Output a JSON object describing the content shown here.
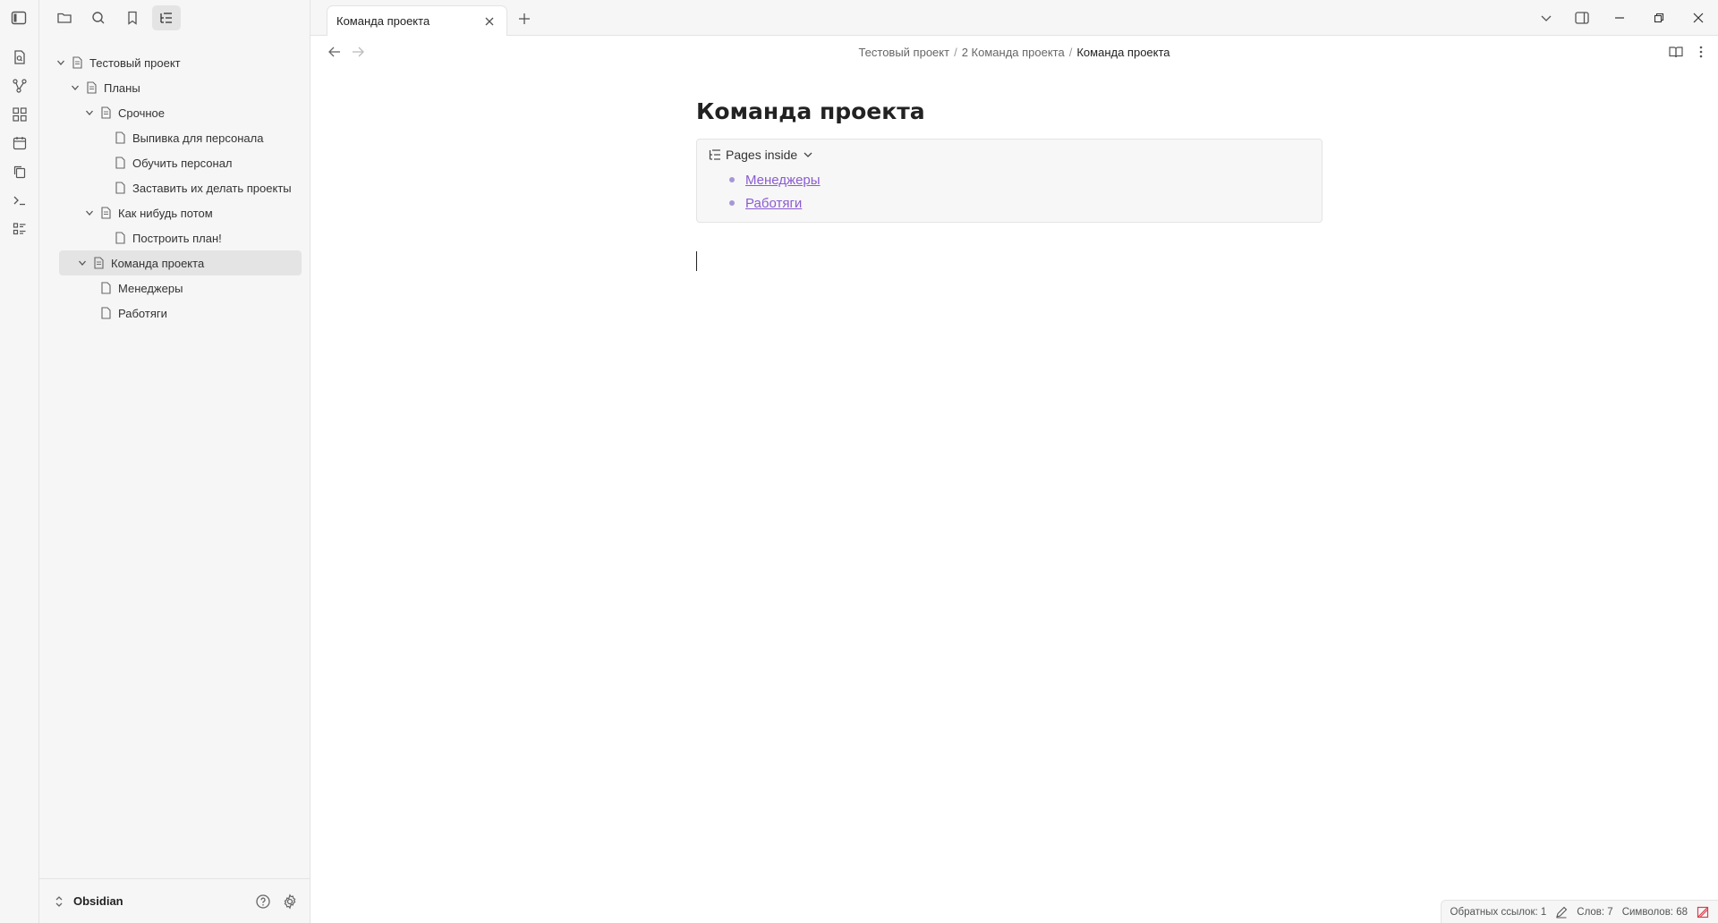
{
  "sidebar": {
    "tree": [
      {
        "label": "Тестовый проект"
      },
      {
        "label": "Планы"
      },
      {
        "label": "Срочное"
      },
      {
        "label": "Выпивка для персонала"
      },
      {
        "label": "Обучить персонал"
      },
      {
        "label": "Заставить их делать проекты"
      },
      {
        "label": "Как нибудь потом"
      },
      {
        "label": "Построить план!"
      },
      {
        "label": "Команда проекта"
      },
      {
        "label": "Менеджеры"
      },
      {
        "label": "Работяги"
      }
    ],
    "vault_name": "Obsidian"
  },
  "tabs": [
    {
      "label": "Команда проекта"
    }
  ],
  "breadcrumb": {
    "items": [
      "Тестовый проект",
      "2 Команда проекта"
    ],
    "current": "Команда проекта",
    "separator": "/"
  },
  "note": {
    "title": "Команда проекта",
    "pages_inside": {
      "label": "Pages inside",
      "links": [
        "Менеджеры",
        "Работяги"
      ]
    }
  },
  "status": {
    "backlinks": "Обратных ссылок: 1",
    "words": "Слов: 7",
    "chars": "Символов: 68"
  },
  "colors": {
    "link": "#8a5cd1",
    "sidebar_bg": "#f6f6f6",
    "selected_bg": "#e4e4e4"
  }
}
